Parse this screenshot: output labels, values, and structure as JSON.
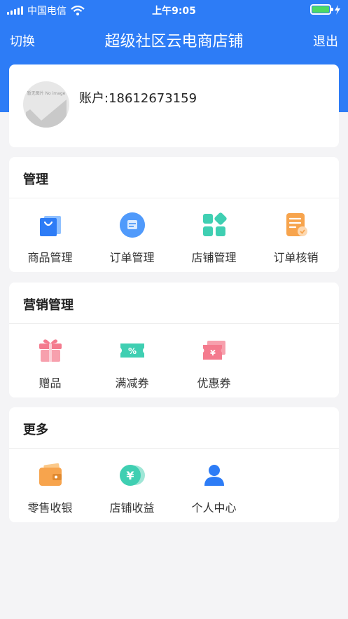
{
  "status_bar": {
    "carrier": "中国电信",
    "time": "上午9:05"
  },
  "nav": {
    "left_label": "切换",
    "title": "超级社区云电商店铺",
    "right_label": "退出"
  },
  "account": {
    "avatar_placeholder": "暂无图片 No image",
    "label": "账户:18612673159"
  },
  "sections": {
    "manage": {
      "title": "管理",
      "items": [
        {
          "label": "商品管理",
          "icon": "shopping-bag-icon"
        },
        {
          "label": "订单管理",
          "icon": "order-icon"
        },
        {
          "label": "店铺管理",
          "icon": "store-grid-icon"
        },
        {
          "label": "订单核销",
          "icon": "verify-document-icon"
        }
      ]
    },
    "marketing": {
      "title": "营销管理",
      "items": [
        {
          "label": "赠品",
          "icon": "gift-icon"
        },
        {
          "label": "满减券",
          "icon": "discount-coupon-icon"
        },
        {
          "label": "优惠券",
          "icon": "coupon-icon"
        }
      ]
    },
    "more": {
      "title": "更多",
      "items": [
        {
          "label": "零售收银",
          "icon": "wallet-icon"
        },
        {
          "label": "店铺收益",
          "icon": "coins-icon"
        },
        {
          "label": "个人中心",
          "icon": "user-icon"
        }
      ]
    }
  },
  "colors": {
    "brand_blue": "#2d7cf6",
    "background": "#f4f4f6",
    "battery_green": "#4cd964"
  }
}
